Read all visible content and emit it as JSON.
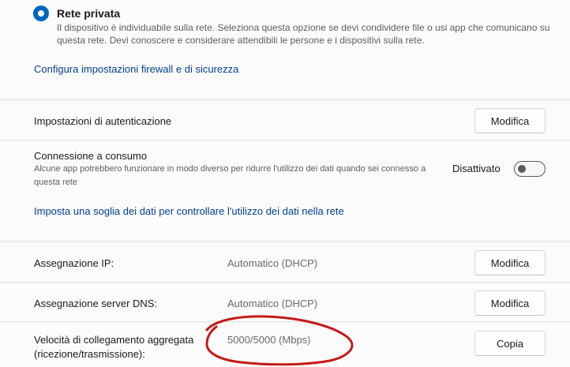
{
  "network_profile": {
    "private": {
      "title": "Rete privata",
      "description": "Il dispositivo è individuabile sulla rete. Seleziona questa opzione se devi condividere file o usi app che comunicano su questa rete. Devi conoscere e considerare attendibili le persone e i dispositivi sulla rete.",
      "selected": true
    },
    "firewall_link": "Configura impostazioni firewall e di sicurezza"
  },
  "authentication": {
    "label": "Impostazioni di autenticazione",
    "button": "Modifica"
  },
  "metered": {
    "label": "Connessione a consumo",
    "description": "Alcune app potrebbero funzionare in modo diverso per ridurre l'utilizzo dei dati quando sei connesso a questa rete",
    "state": "Disattivato",
    "data_limit_link": "Imposta una soglia dei dati per controllare l'utilizzo dei dati nella rete"
  },
  "ip_assignment": {
    "label": "Assegnazione IP:",
    "value": "Automatico (DHCP)",
    "button": "Modifica"
  },
  "dns_assignment": {
    "label": "Assegnazione server DNS:",
    "value": "Automatico (DHCP)",
    "button": "Modifica"
  },
  "link_speed": {
    "label_line1": "Velocità di collegamento aggregata",
    "label_line2": "(ricezione/trasmissione):",
    "value": "5000/5000 (Mbps)",
    "button": "Copia"
  },
  "colors": {
    "accent": "#0067c0",
    "link": "#003e92",
    "annotation": "#c41a1a"
  }
}
